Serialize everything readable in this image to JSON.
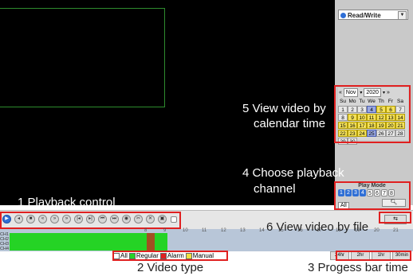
{
  "mode_select": {
    "value": "Read/Write"
  },
  "calendar": {
    "month": "Nov",
    "year": "2020",
    "prev": "«",
    "next": "»",
    "weekdays": [
      "Su",
      "Mo",
      "Tu",
      "We",
      "Th",
      "Fr",
      "Sa"
    ],
    "days": [
      [
        "",
        "",
        ""
      ],
      [
        "1",
        "2",
        "3",
        "4",
        "5",
        "6",
        "7"
      ],
      [
        "8",
        "9",
        "10",
        "11",
        "12",
        "13",
        "14"
      ],
      [
        "15",
        "16",
        "17",
        "18",
        "19",
        "20",
        "21"
      ],
      [
        "22",
        "23",
        "24",
        "25",
        "26",
        "27",
        "28"
      ],
      [
        "29",
        "30"
      ]
    ]
  },
  "play_mode": {
    "title": "Play Mode",
    "channels": [
      "1",
      "2",
      "3",
      "4",
      "5",
      "6",
      "7",
      "8"
    ],
    "all_label": "All"
  },
  "timeline": {
    "ticks": [
      "8",
      "9",
      "10",
      "11",
      "12",
      "13",
      "14",
      "15",
      "16",
      "17",
      "18",
      "19",
      "20",
      "21",
      "22",
      "23"
    ],
    "channels": [
      "CH1",
      "CH2",
      "CH3",
      "CH4"
    ]
  },
  "video_type": {
    "all": "All",
    "regular": "Regular",
    "alarm": "Alarm",
    "manual": "Manual"
  },
  "progress_bar": {
    "options": [
      "24hr",
      "2hr",
      "1hr",
      "30min"
    ]
  },
  "annotations": {
    "a1": "1 Playback control",
    "a2": "2 Video type",
    "a3": "3 Progess bar time",
    "a4_line1": "4 Choose playback",
    "a4_line2": "channel",
    "a5_line1": "5 View video by",
    "a5_line2": "calendar time",
    "a6": "6 View video by file"
  },
  "colors": {
    "record_regular": "#25d325",
    "record_alarm": "#c03020",
    "manual": "#f0e040",
    "highlight": "#e02020"
  }
}
